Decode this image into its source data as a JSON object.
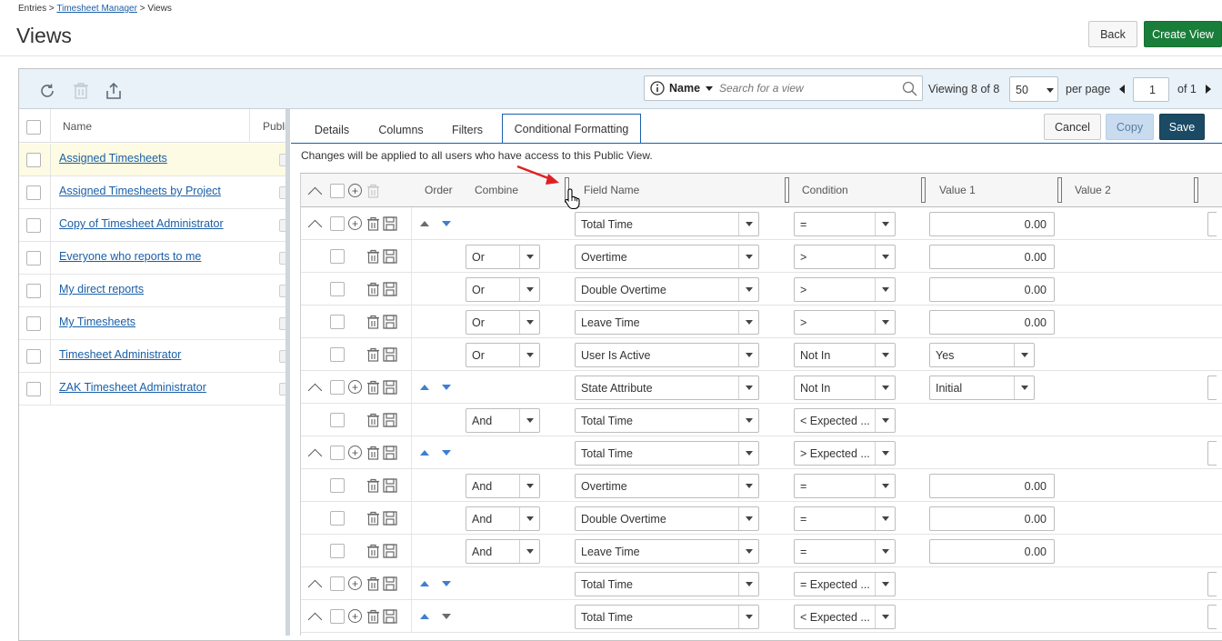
{
  "breadcrumb": {
    "root": "Entries",
    "sep1": ">",
    "parent": "Timesheet Manager",
    "sep2": ">",
    "current": "Views"
  },
  "page": {
    "title": "Views",
    "back_label": "Back",
    "create_label": "Create View"
  },
  "toolbar": {
    "search_field": "Name",
    "search_placeholder": "Search for a view",
    "viewing_prefix": "Viewing",
    "viewing_count": "8",
    "viewing_of": "of",
    "viewing_total": "8",
    "page_size": "50",
    "per_page": "per page",
    "page_number": "1",
    "page_of": "of 1"
  },
  "list": {
    "col_name": "Name",
    "col_public": "Publi",
    "items": [
      {
        "label": "Assigned Timesheets"
      },
      {
        "label": "Assigned Timesheets by Project"
      },
      {
        "label": "Copy of Timesheet Administrator"
      },
      {
        "label": "Everyone who reports to me"
      },
      {
        "label": "My direct reports"
      },
      {
        "label": "My Timesheets"
      },
      {
        "label": "Timesheet Administrator"
      },
      {
        "label": "ZAK Timesheet Administrator"
      }
    ]
  },
  "tabs": [
    {
      "label": "Details"
    },
    {
      "label": "Columns"
    },
    {
      "label": "Filters"
    },
    {
      "label": "Conditional Formatting"
    }
  ],
  "actions": {
    "cancel_label": "Cancel",
    "copy_label": "Copy",
    "save_label": "Save"
  },
  "notice": "Changes will be applied to all users who have access to this Public View.",
  "grid": {
    "headers": {
      "order": "Order",
      "combine": "Combine",
      "field": "Field Name",
      "condition": "Condition",
      "value1": "Value 1",
      "value2": "Value 2"
    },
    "rows": [
      {
        "group": true,
        "combine": "",
        "field": "Total Time",
        "condition": "=",
        "value1": "0.00",
        "value_type": "num",
        "up_dim": true,
        "down_dim": false
      },
      {
        "group": false,
        "combine": "Or",
        "field": "Overtime",
        "condition": ">",
        "value1": "0.00",
        "value_type": "num"
      },
      {
        "group": false,
        "combine": "Or",
        "field": "Double Overtime",
        "condition": ">",
        "value1": "0.00",
        "value_type": "num"
      },
      {
        "group": false,
        "combine": "Or",
        "field": "Leave Time",
        "condition": ">",
        "value1": "0.00",
        "value_type": "num"
      },
      {
        "group": false,
        "combine": "Or",
        "field": "User Is Active",
        "condition": "Not In",
        "value1": "Yes",
        "value_type": "select"
      },
      {
        "group": true,
        "combine": "",
        "field": "State Attribute",
        "condition": "Not In",
        "value1": "Initial",
        "value_type": "select",
        "up_dim": false,
        "down_dim": false
      },
      {
        "group": false,
        "combine": "And",
        "field": "Total Time",
        "condition": "< Expected ...",
        "value1": "",
        "value_type": "none"
      },
      {
        "group": true,
        "combine": "",
        "field": "Total Time",
        "condition": "> Expected ...",
        "value1": "",
        "value_type": "none",
        "up_dim": false,
        "down_dim": false
      },
      {
        "group": false,
        "combine": "And",
        "field": "Overtime",
        "condition": "=",
        "value1": "0.00",
        "value_type": "num"
      },
      {
        "group": false,
        "combine": "And",
        "field": "Double Overtime",
        "condition": "=",
        "value1": "0.00",
        "value_type": "num"
      },
      {
        "group": false,
        "combine": "And",
        "field": "Leave Time",
        "condition": "=",
        "value1": "0.00",
        "value_type": "num"
      },
      {
        "group": true,
        "combine": "",
        "field": "Total Time",
        "condition": "= Expected ...",
        "value1": "",
        "value_type": "none",
        "up_dim": false,
        "down_dim": false
      },
      {
        "group": true,
        "combine": "",
        "field": "Total Time",
        "condition": "< Expected ...",
        "value1": "",
        "value_type": "none",
        "up_dim": false,
        "down_dim": true
      }
    ]
  },
  "colors": {
    "link": "#1a5fa8",
    "create": "#1a7e3b",
    "save": "#1b4a65",
    "toolbar_bg": "#e9f2f9",
    "selected_row": "#fdfbe3",
    "arrow_annotation": "#e02020"
  },
  "icons": [
    "refresh-icon",
    "trash-icon",
    "export-icon",
    "info-icon",
    "search-icon",
    "caret-left-icon",
    "caret-right-icon",
    "collapse-icon",
    "add-circle-icon",
    "save-icon",
    "order-up-icon",
    "order-down-icon",
    "hand-cursor-icon"
  ]
}
